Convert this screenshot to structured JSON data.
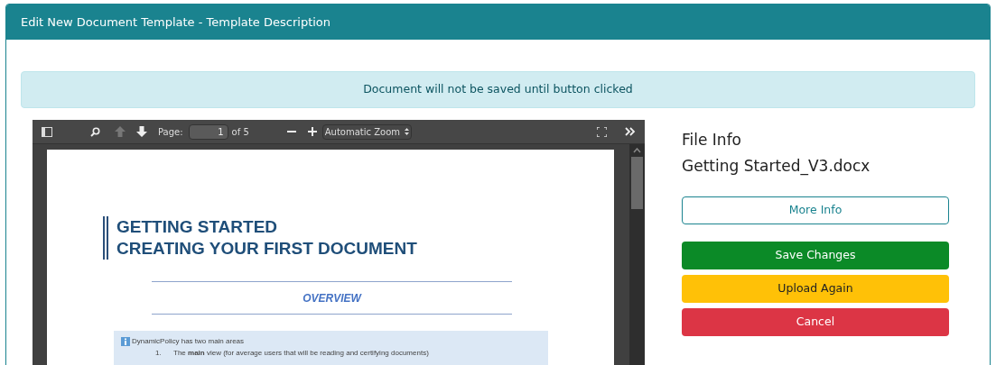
{
  "window": {
    "title": "Edit New Document Template - Template Description"
  },
  "alert": "Document will not be saved until button clicked",
  "viewer": {
    "toolbar": {
      "nav_buttons": [
        {
          "kind": "up",
          "disabled": true
        },
        {
          "kind": "down",
          "disabled": false
        }
      ],
      "page_label": "Page:",
      "page_value": "1",
      "page_count": "of 5",
      "zoom": "Automatic Zoom"
    },
    "document": {
      "title_lines": [
        "GETTING STARTED",
        "CREATING YOUR FIRST DOCUMENT"
      ],
      "section": "OVERVIEW",
      "info_text": "DynamicPolicy has two main areas",
      "list_items": [
        {
          "number": "1.",
          "text": "The **main** view (for average users that will be reading and certifying documents)"
        }
      ]
    }
  },
  "file_info": {
    "heading": "File Info",
    "filename": "Getting Started_V3.docx"
  },
  "buttons": [
    {
      "label": "More Info",
      "kind": "outline"
    },
    {
      "label": "Save Changes",
      "kind": "success"
    },
    {
      "label": "Upload Again",
      "kind": "warning"
    },
    {
      "label": "Cancel",
      "kind": "danger"
    }
  ]
}
